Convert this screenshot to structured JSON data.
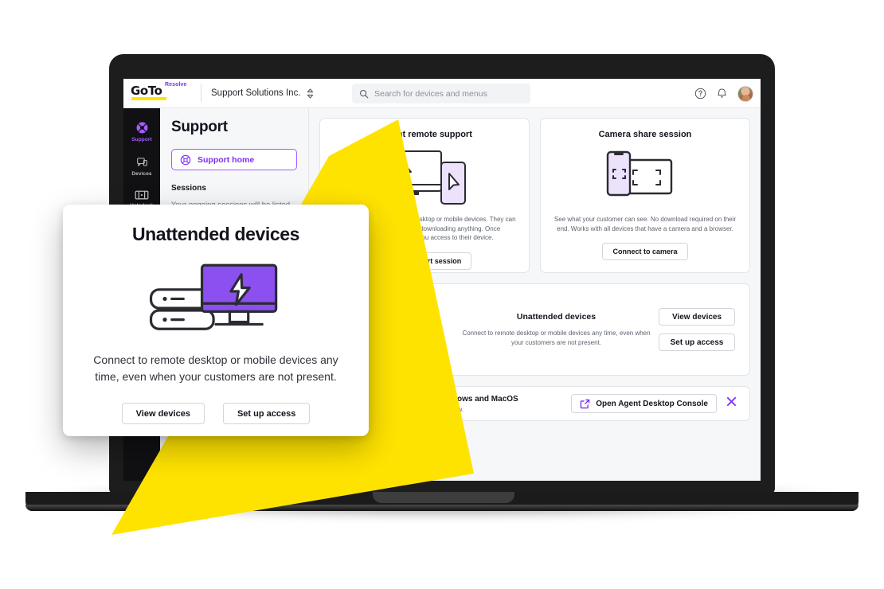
{
  "header": {
    "logo_main": "GoTo",
    "logo_sub": "Resolve",
    "org_name": "Support Solutions Inc.",
    "search_placeholder": "Search for devices and menus",
    "help_icon": "help-circle-icon",
    "bell_icon": "bell-icon",
    "avatar_icon": "user-avatar"
  },
  "sidebar": {
    "items": [
      {
        "label": "Support",
        "icon": "support-lifebuoy-icon",
        "active": true
      },
      {
        "label": "Devices",
        "icon": "devices-icon",
        "active": false
      },
      {
        "label": "Helpdesk",
        "icon": "helpdesk-ticket-icon",
        "active": false
      }
    ]
  },
  "left_panel": {
    "title": "Support",
    "support_home_label": "Support home",
    "sessions_title": "Sessions",
    "sessions_desc": "Your ongoing sessions will be listed here."
  },
  "content": {
    "cards": [
      {
        "title": "Instant remote support",
        "desc": "Connect to your customers' desktop or mobile devices. They can join your session without downloading anything. Once connected, they grant you access to their device.",
        "button": "Start support session",
        "art": "screen-to-phone-cursor-art"
      },
      {
        "title": "Camera share session",
        "desc": "See what your customer can see. No download required on their end. Works with all devices that have a camera and a browser.",
        "button": "Connect to camera",
        "art": "phone-camera-frame-art"
      }
    ],
    "unattended": {
      "title": "Unattended devices",
      "desc": "Connect to remote desktop or mobile devices any time, even when your customers are not present.",
      "buttons": [
        "View devices",
        "Set up access"
      ],
      "art": "servers-monitor-bolt-art"
    },
    "banner": {
      "title": "Agent Desktop Console for Windows and MacOS",
      "subtitle": "Run your support sessions in a native window.",
      "button": "Open Agent Desktop Console",
      "button_icon": "external-link-icon",
      "close_icon": "close-x-icon"
    }
  },
  "overlay": {
    "title": "Unattended devices",
    "desc": "Connect to remote desktop or mobile devices any time, even when your customers are not present.",
    "buttons": [
      "View devices",
      "Set up access"
    ],
    "art": "servers-monitor-bolt-art"
  },
  "colors": {
    "purple": "#7b2ff2",
    "purple_light": "#a45dff",
    "yellow": "#ffe300",
    "dark": "#111114",
    "panel_bg": "#f6f7f9"
  }
}
